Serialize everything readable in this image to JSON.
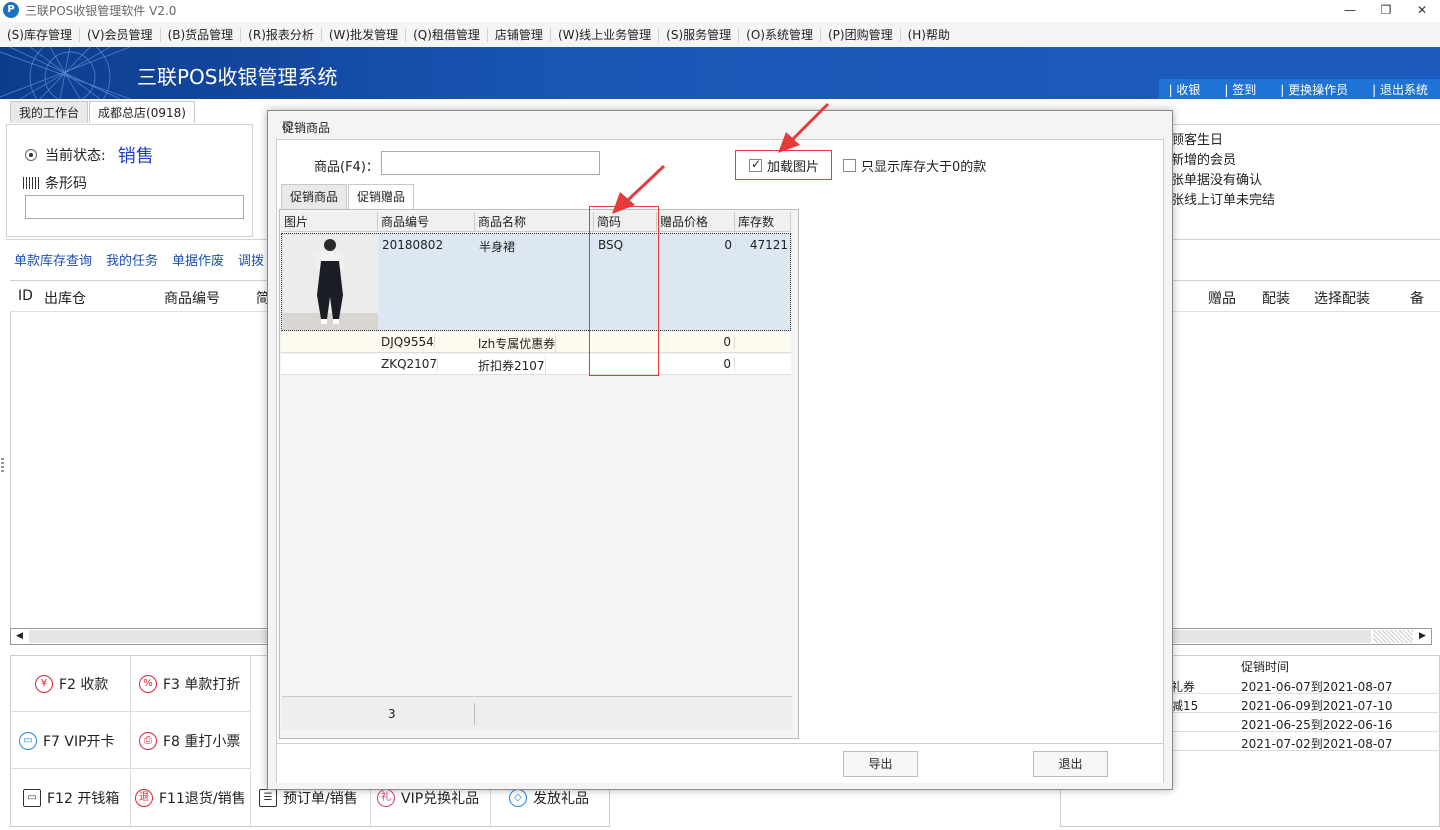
{
  "window": {
    "title": "三联POS收银管理软件 V2.0",
    "logo_letter": "P",
    "controls": [
      "—",
      "❐",
      "✕"
    ]
  },
  "menu": [
    "(S)库存管理",
    "(V)会员管理",
    "(B)货品管理",
    "(R)报表分析",
    "(W)批发管理",
    "(Q)租借管理",
    "店铺管理",
    "(W)线上业务管理",
    "(S)服务管理",
    "(O)系统管理",
    "(P)团购管理",
    "(H)帮助"
  ],
  "banner": {
    "title": "三联POS收银管理系统",
    "quick_links": [
      "| 收银",
      "| 签到",
      "| 更换操作员",
      "| 退出系统"
    ]
  },
  "main_tabs": [
    "我的工作台",
    "成都总店(0918)"
  ],
  "left_panel": {
    "status_label": "当前状态:",
    "status_value": "销售",
    "barcode_label": "条形码",
    "barcode_value": ""
  },
  "right_top": [
    "顾客生日",
    "新增的会员",
    "张单据没有确认",
    "张线上订单未完结"
  ],
  "links": [
    "单款库存查询",
    "我的任务",
    "单据作废",
    "调拨"
  ],
  "main_grid_headers": {
    "id": "ID",
    "warehouse": "出库仓",
    "product_code": "商品编号",
    "short": "简",
    "gift": "赠品",
    "assembly": "配装",
    "select_assembly": "选择配装",
    "notes": "备"
  },
  "function_buttons": [
    {
      "key": "F2 收款",
      "icon": "¥"
    },
    {
      "key": "F3 单款打折",
      "icon": "%"
    },
    {
      "key": "F7 VIP开卡",
      "icon": "▭"
    },
    {
      "key": "F8 重打小票",
      "icon": "⎙"
    },
    {
      "key": "F12 开钱箱",
      "icon": "▭"
    },
    {
      "key": "F11退货/销售",
      "icon": "退"
    },
    {
      "key": "预订单/销售",
      "icon": "☰"
    },
    {
      "key": "VIP兑换礼品",
      "icon": "礼"
    },
    {
      "key": "发放礼品",
      "icon": "◇"
    }
  ],
  "promo_table": {
    "header": "促销时间",
    "rows": [
      {
        "name": "礼券",
        "time": "2021-06-07到2021-08-07"
      },
      {
        "name": "减15",
        "time": "2021-06-09到2021-07-10"
      },
      {
        "name": "",
        "time": "2021-06-25到2022-06-16"
      },
      {
        "name": "",
        "time": "2021-07-02到2021-08-07"
      }
    ]
  },
  "modal": {
    "title": "促销商品",
    "close": "☒",
    "search_label": "商品(F4)：",
    "search_value": "",
    "load_images_label": "加载图片",
    "load_images_checked": true,
    "stock_only_label": "只显示库存大于0的款",
    "stock_only_checked": false,
    "tabs": [
      "促销商品",
      "促销赠品"
    ],
    "active_tab": "促销赠品",
    "columns": [
      "图片",
      "商品编号",
      "商品名称",
      "简码",
      "赠品价格",
      "库存数"
    ],
    "rows": [
      {
        "code": "20180802",
        "name": "半身裙",
        "short": "BSQ",
        "price": "0",
        "stock": "47121"
      },
      {
        "code": "DJQ9554",
        "name": "lzh专属优惠券",
        "short": "",
        "price": "0",
        "stock": ""
      },
      {
        "code": "ZKQ2107",
        "name": "折扣券2107",
        "short": "",
        "price": "0",
        "stock": ""
      }
    ],
    "row_count": "3",
    "buttons": {
      "export": "导出",
      "exit": "退出"
    }
  },
  "colors": {
    "banner": "#1a56b6",
    "accent_blue": "#1d3fc2",
    "annotation_red": "#e53b3b",
    "selected_row": "#dde7f3"
  }
}
